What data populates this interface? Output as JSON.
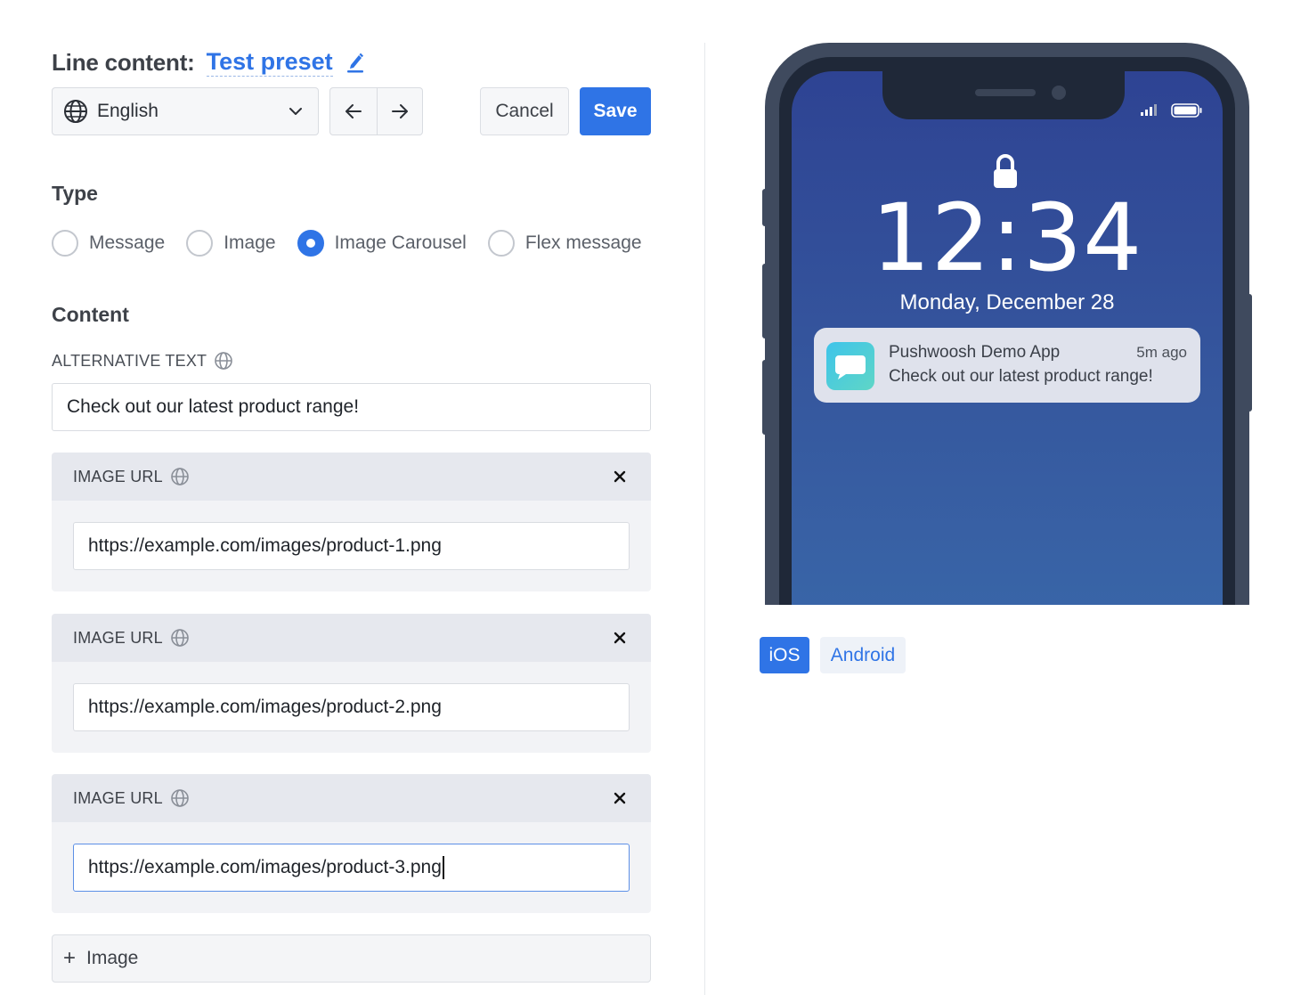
{
  "header": {
    "label": "Line content:",
    "preset_name": "Test preset",
    "edit_icon": "pencil-icon"
  },
  "controls": {
    "language": "English",
    "language_icon": "globe-icon",
    "prev_icon": "arrow-left-icon",
    "next_icon": "arrow-right-icon",
    "cancel_label": "Cancel",
    "save_label": "Save"
  },
  "type_section": {
    "title": "Type",
    "options": [
      {
        "label": "Message",
        "checked": false
      },
      {
        "label": "Image",
        "checked": false
      },
      {
        "label": "Image Carousel",
        "checked": true
      },
      {
        "label": "Flex message",
        "checked": false
      }
    ]
  },
  "content_section": {
    "title": "Content",
    "alt_text_label": "ALTERNATIVE TEXT",
    "alt_text_value": "Check out our latest product range!",
    "image_cards": [
      {
        "label": "IMAGE URL",
        "url": "https://example.com/images/product-1.png",
        "focused": false
      },
      {
        "label": "IMAGE URL",
        "url": "https://example.com/images/product-2.png",
        "focused": false
      },
      {
        "label": "IMAGE URL",
        "url": "https://example.com/images/product-3.png",
        "focused": true
      }
    ],
    "add_image_label": "Image"
  },
  "preview": {
    "time": "12:34",
    "date": "Monday, December 28",
    "notification": {
      "app_name": "Pushwoosh Demo App",
      "time_ago": "5m ago",
      "message": "Check out our latest product range!"
    },
    "tabs": [
      "iOS",
      "Android"
    ],
    "active_tab": "iOS"
  },
  "colors": {
    "accent": "#2f74e6",
    "screen_top": "#2e4393",
    "screen_bottom": "#3a6aab"
  }
}
